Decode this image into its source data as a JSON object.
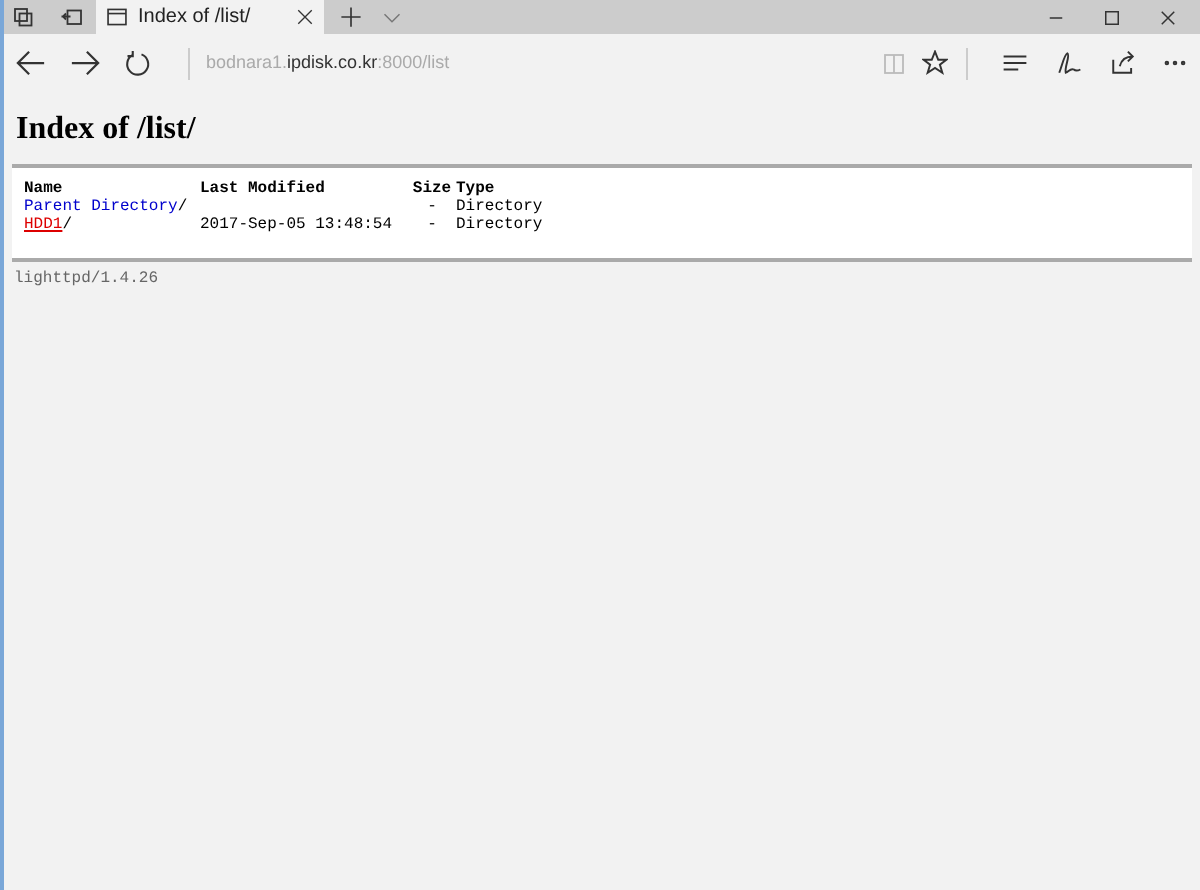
{
  "tab": {
    "title": "Index of /list/"
  },
  "address": {
    "before": "bodnara1.",
    "host": "ipdisk.co.kr",
    "after": ":8000/list"
  },
  "heading": "Index of /list/",
  "table": {
    "columns": [
      "Name",
      "Last Modified",
      "Size",
      "Type"
    ],
    "rows": [
      {
        "name": "Parent Directory",
        "suffix": "/",
        "modified": "",
        "size": "-",
        "type": "Directory",
        "hovered": false
      },
      {
        "name": "HDD1",
        "suffix": "/",
        "modified": "2017-Sep-05 13:48:54",
        "size": "-",
        "type": "Directory",
        "hovered": true
      }
    ]
  },
  "footer": "lighttpd/1.4.26"
}
